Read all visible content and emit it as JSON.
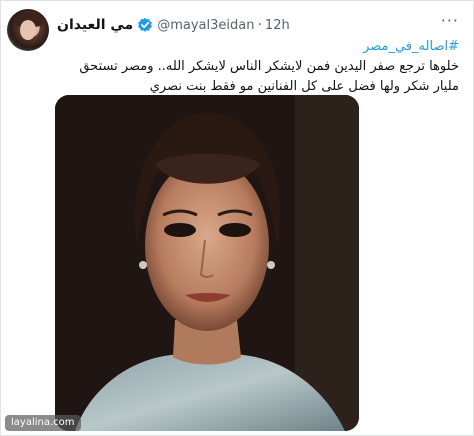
{
  "tweet": {
    "author": {
      "name": "مي العيدان",
      "handle": "@mayal3eidan",
      "separator": "·",
      "time": "12h"
    },
    "more_menu": "···",
    "hashtag": "#اصاله_في_مصر",
    "text": "خلوها ترجع صفر اليدين فمن لايشكر الناس لايشكر الله.. ومصر تستحق مليار شكر ولها فضل على كل الفنانين مو فقط بنت نصري"
  },
  "watermark": "layalina.com",
  "colors": {
    "link": "#1d9bf0",
    "text": "#0f1419",
    "muted": "#536471"
  }
}
